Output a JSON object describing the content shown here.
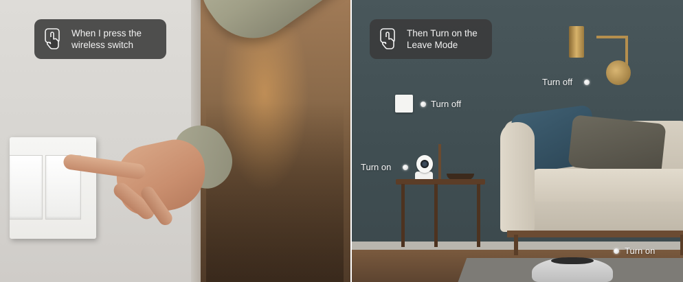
{
  "left_card": {
    "text": "When I press the\nwireless switch",
    "icon": "tap-hand-icon"
  },
  "right_card": {
    "text": "Then Turn on the\nLeave Mode",
    "icon": "tap-hand-icon"
  },
  "labels": {
    "lamp": "Turn off",
    "wall_switch": "Turn off",
    "camera": "Turn on",
    "robot": "Turn on"
  }
}
